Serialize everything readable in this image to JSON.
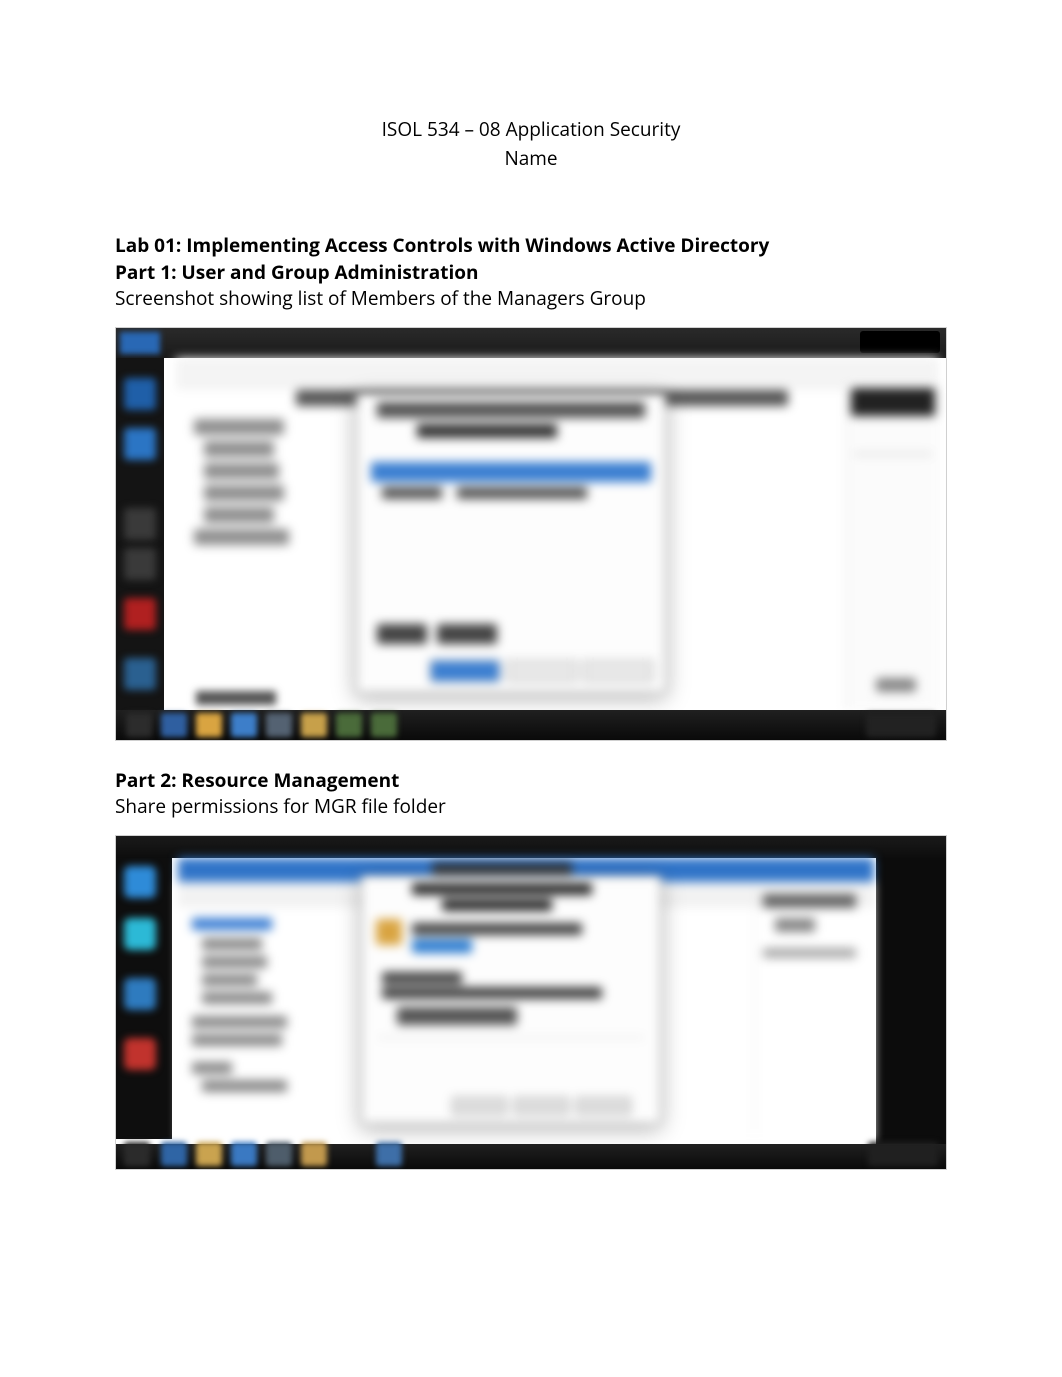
{
  "header": {
    "course": "ISOL 534 – 08 Application Security",
    "author": "Name"
  },
  "lab": {
    "title": "Lab 01: Implementing Access Controls with Windows Active Directory"
  },
  "part1": {
    "title": "Part 1: User and Group Administration",
    "caption": "Screenshot showing list of Members of the Managers Group"
  },
  "part2": {
    "title": "Part 2: Resource Management",
    "caption": "Share permissions for MGR file folder"
  }
}
